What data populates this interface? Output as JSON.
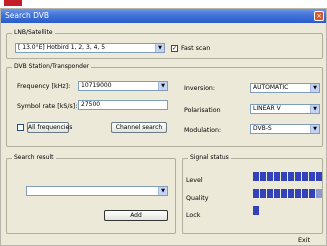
{
  "window": {
    "title": "Search DVB",
    "close_glyph": "×"
  },
  "lnb": {
    "group_label": "LNB/Satellite",
    "value": "[ 13.0°E] Hotbird 1, 2, 3, 4, 5",
    "fast_scan_label": "Fast scan",
    "fast_scan_checked": true
  },
  "station": {
    "group_label": "DVB Station/Transponder",
    "frequency_label": "Frequency [kHz]:",
    "frequency_value": "10719000",
    "symbol_rate_label": "Symbol rate [kS/s]:",
    "symbol_rate_value": "27500",
    "all_frequencies_label": "All frequencies",
    "channel_search_label": "Channel search",
    "inversion_label": "Inversion:",
    "inversion_value": "AUTOMATIC",
    "polarisation_label": "Polarisation",
    "polarisation_value": "LINEAR V",
    "modulation_label": "Modulation:",
    "modulation_value": "DVB-S"
  },
  "search_result": {
    "group_label": "Search result",
    "value": "",
    "add_label": "Add"
  },
  "signal": {
    "group_label": "Signal status",
    "level_label": "Level",
    "quality_label": "Quality",
    "lock_label": "Lock",
    "level_segments_on": 10,
    "level_segments_total": 10,
    "quality_segments_on": 9,
    "quality_segments_total": 10,
    "lock_on": true,
    "bar_color": "#3242b8"
  },
  "footer": {
    "exit_label": "Exit"
  },
  "icons": {
    "dropdown": "chevron-down-icon",
    "check": "checkmark-icon"
  }
}
